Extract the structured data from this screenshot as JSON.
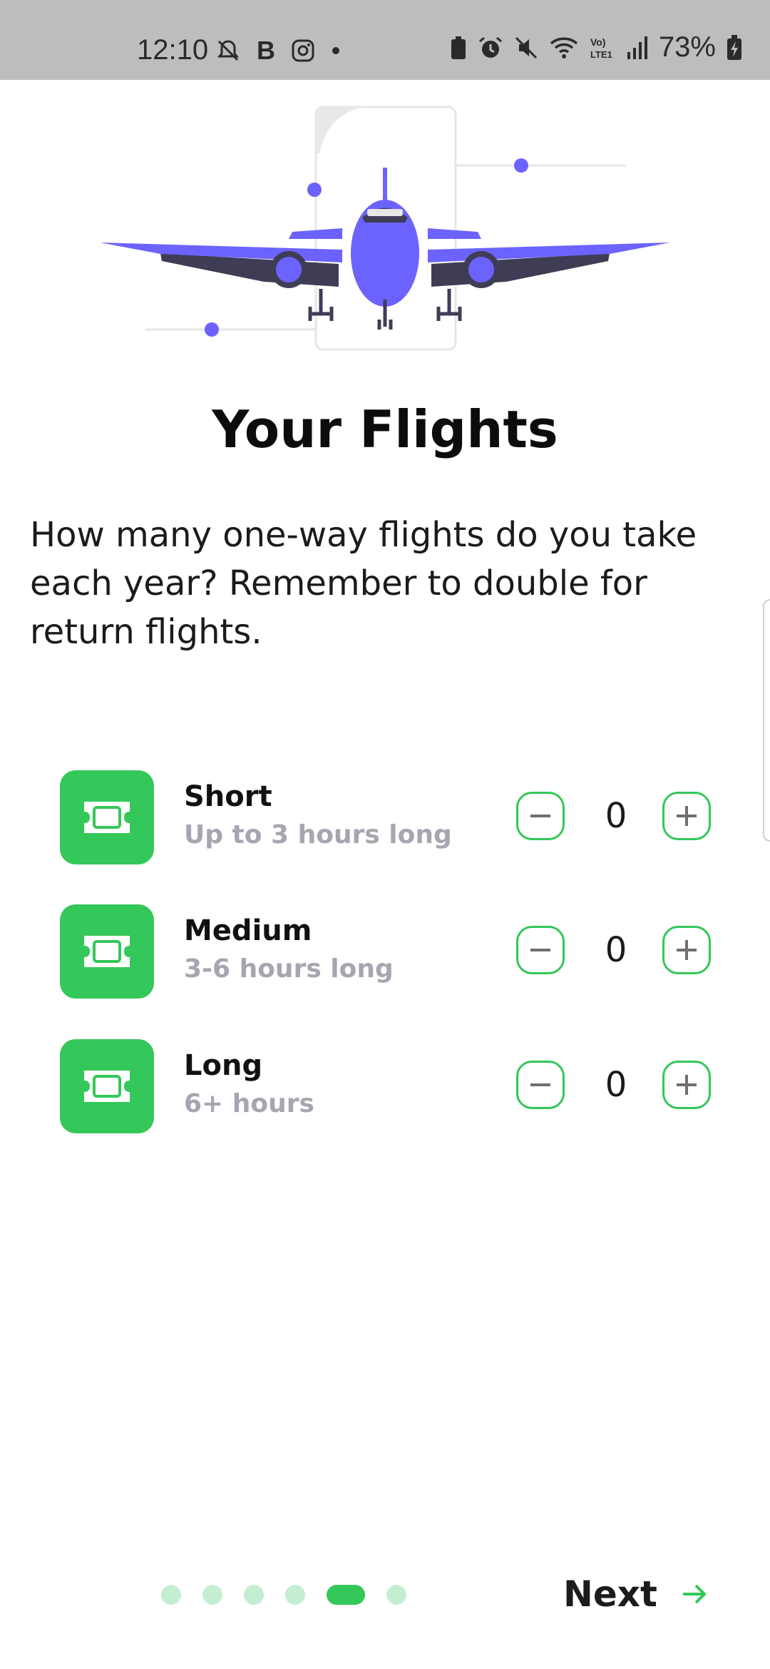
{
  "status_bar": {
    "time": "12:10",
    "left_icons": [
      "notifications-off-icon",
      "b-app-icon",
      "instagram-icon",
      "dot-icon"
    ],
    "right_icons": [
      "battery-saver-icon",
      "alarm-icon",
      "mute-icon",
      "wifi-icon",
      "volte-icon",
      "signal-icon"
    ],
    "battery": "73%"
  },
  "illustration": {
    "name": "airplane-illustration",
    "accent": "#6c63ff"
  },
  "page": {
    "title": "Your Flights",
    "description": "How many one-way flights do you take each year? Remember to double for return flights."
  },
  "flights": [
    {
      "name": "Short",
      "sub": "Up to 3 hours long",
      "value": "0"
    },
    {
      "name": "Medium",
      "sub": "3-6 hours long",
      "value": "0"
    },
    {
      "name": "Long",
      "sub": "6+ hours",
      "value": "0"
    }
  ],
  "pager": {
    "count": 6,
    "active_index": 4
  },
  "footer": {
    "next_label": "Next"
  },
  "colors": {
    "accent": "#34c759",
    "dot_inactive": "#c4eed2",
    "subtext": "#a6a6b0",
    "illustration": "#6c63ff"
  }
}
